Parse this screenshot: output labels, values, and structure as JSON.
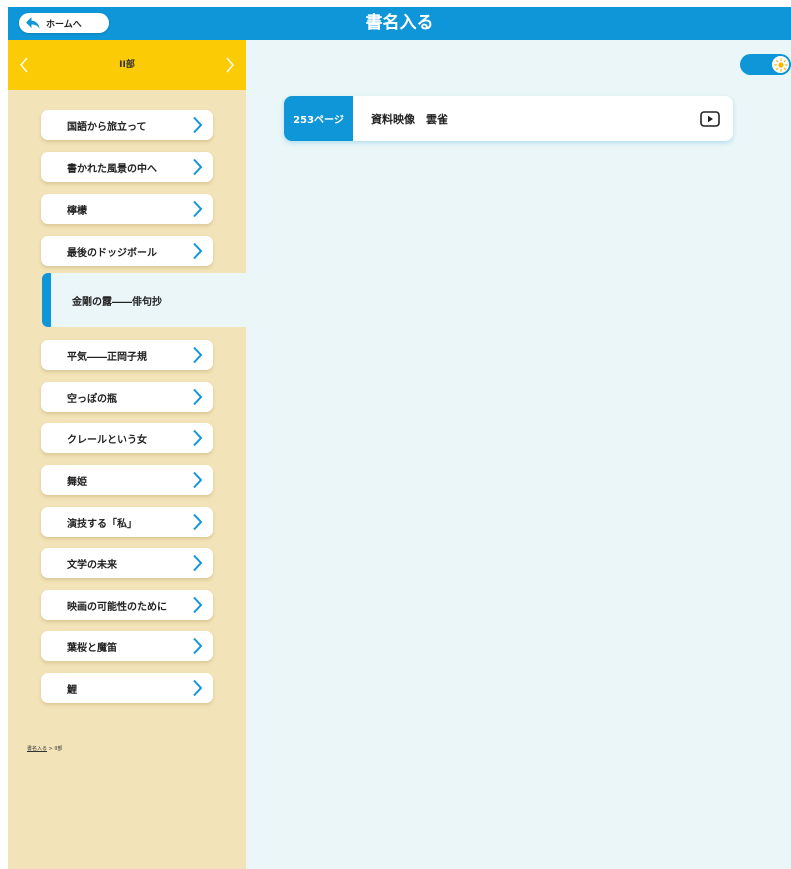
{
  "header": {
    "home_label": "ホームへ",
    "title": "書名入る",
    "home_icon": "back-arrow-icon"
  },
  "sidebar": {
    "part_label": "II部",
    "prev_icon": "chevron-left-icon",
    "next_icon": "chevron-right-icon",
    "items": [
      {
        "label": "国語から旅立って",
        "active": false
      },
      {
        "label": "書かれた風景の中へ",
        "active": false
      },
      {
        "label": "檸檬",
        "active": false
      },
      {
        "label": "最後のドッジボール",
        "active": false
      },
      {
        "label": "金剛の露――俳句抄",
        "active": true
      },
      {
        "label": "平気――正岡子規",
        "active": false
      },
      {
        "label": "空っぽの瓶",
        "active": false
      },
      {
        "label": "クレールという女",
        "active": false
      },
      {
        "label": "舞姫",
        "active": false
      },
      {
        "label": "演技する「私」",
        "active": false
      },
      {
        "label": "文学の未来",
        "active": false
      },
      {
        "label": "映画の可能性のために",
        "active": false
      },
      {
        "label": "葉桜と魔笛",
        "active": false
      },
      {
        "label": "鯉",
        "active": false
      }
    ],
    "breadcrumb": {
      "root": "書名入る",
      "separator": " > ",
      "current": "II部"
    }
  },
  "main": {
    "theme_toggle_icon": "sun-icon",
    "cards": [
      {
        "page": "253ページ",
        "title": "資料映像　雲雀",
        "icon": "play-icon"
      }
    ]
  },
  "colors": {
    "accent_blue": "#0e96d8",
    "part_bar_yellow": "#fbcb05",
    "sidebar_bg": "#f2e3b8",
    "main_bg": "#eaf6f7"
  }
}
